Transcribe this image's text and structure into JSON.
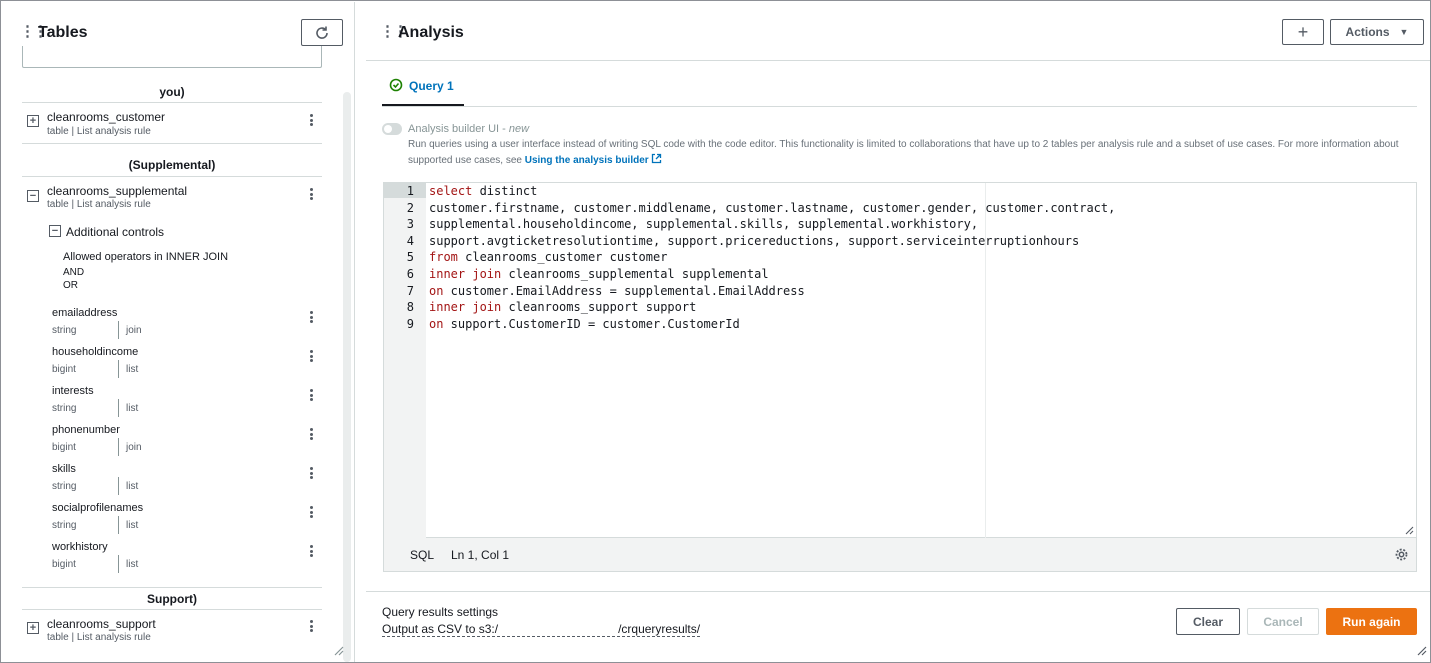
{
  "left_panel": {
    "title": "Tables",
    "groups": [
      {
        "label": "you)"
      },
      {
        "label": "(Supplemental)"
      },
      {
        "label": "Support)"
      }
    ],
    "tables": {
      "customer": {
        "name": "cleanrooms_customer",
        "sub": "table | List analysis rule"
      },
      "supplemental": {
        "name": "cleanrooms_supplemental",
        "sub": "table | List analysis rule"
      },
      "support": {
        "name": "cleanrooms_support",
        "sub": "table | List analysis rule"
      }
    },
    "additional_controls": {
      "label": "Additional controls",
      "operators_title": "Allowed operators in INNER JOIN",
      "operators": [
        "AND",
        "OR"
      ]
    },
    "columns": [
      {
        "name": "emailaddress",
        "type": "string",
        "rule": "join"
      },
      {
        "name": "householdincome",
        "type": "bigint",
        "rule": "list"
      },
      {
        "name": "interests",
        "type": "string",
        "rule": "list"
      },
      {
        "name": "phonenumber",
        "type": "bigint",
        "rule": "join"
      },
      {
        "name": "skills",
        "type": "string",
        "rule": "list"
      },
      {
        "name": "socialprofilenames",
        "type": "string",
        "rule": "list"
      },
      {
        "name": "workhistory",
        "type": "bigint",
        "rule": "list"
      }
    ]
  },
  "right_panel": {
    "title": "Analysis",
    "add_label": "+",
    "actions_label": "Actions",
    "tab_label": "Query 1",
    "builder": {
      "label": "Analysis builder UI",
      "tag": "new",
      "description": "Run queries using a user interface instead of writing SQL code with the code editor. This functionality is limited to collaborations that have up to 2 tables per analysis rule and a subset of use cases. For more information about",
      "description2": "supported use cases, see",
      "link": "Using the analysis builder"
    },
    "editor": {
      "lines": [
        {
          "n": "1",
          "kw": "select",
          "rest": " distinct"
        },
        {
          "n": "2",
          "kw": "",
          "rest": "customer.firstname, customer.middlename, customer.lastname, customer.gender, customer.contract,"
        },
        {
          "n": "3",
          "kw": "",
          "rest": "supplemental.householdincome, supplemental.skills, supplemental.workhistory,"
        },
        {
          "n": "4",
          "kw": "",
          "rest": "support.avgticketresolutiontime, support.pricereductions, support.serviceinterruptionhours"
        },
        {
          "n": "5",
          "kw": "from",
          "rest": " cleanrooms_customer customer"
        },
        {
          "n": "6",
          "kw": "inner join",
          "rest": " cleanrooms_supplemental supplemental"
        },
        {
          "n": "7",
          "kw": "on",
          "rest": " customer.EmailAddress = supplemental.EmailAddress"
        },
        {
          "n": "8",
          "kw": "inner join",
          "rest": " cleanrooms_support support"
        },
        {
          "n": "9",
          "kw": "on",
          "rest": " support.CustomerID = customer.CustomerId"
        }
      ],
      "language": "SQL",
      "position": "Ln 1, Col 1"
    },
    "results": {
      "title": "Query results settings",
      "output_prefix": "Output as CSV to s3:/",
      "output_suffix": "/crqueryresults/"
    },
    "buttons": {
      "clear": "Clear",
      "cancel": "Cancel",
      "run": "Run again"
    }
  },
  "colors": {
    "accent": "#ec7211",
    "link": "#0073bb",
    "success": "#1d8102",
    "keyword": "#a31515"
  }
}
